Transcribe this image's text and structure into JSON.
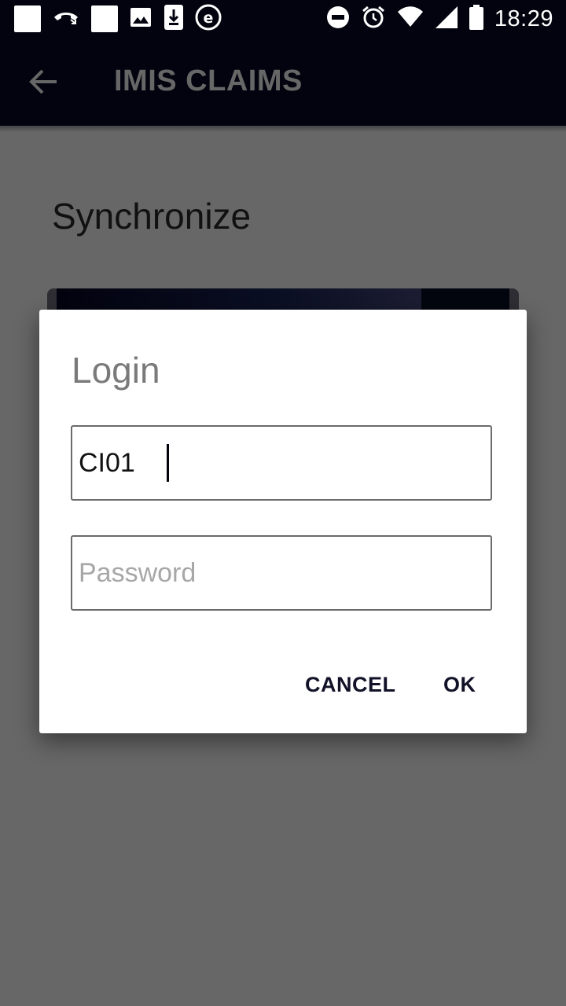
{
  "status_bar": {
    "time": "18:29",
    "left_icons": [
      "blank-notification-icon",
      "missed-call-icon",
      "blank-notification-icon",
      "image-icon",
      "download-icon",
      "e-app-icon"
    ],
    "right_icons": [
      "do-not-disturb-icon",
      "alarm-icon",
      "wifi-icon",
      "signal-icon",
      "battery-icon"
    ]
  },
  "app_bar": {
    "title": "IMIS CLAIMS",
    "back_icon": "arrow-left-icon"
  },
  "page": {
    "heading": "Synchronize"
  },
  "dialog": {
    "title": "Login",
    "username_value": "CI01",
    "password_placeholder": "Password",
    "cancel_label": "CANCEL",
    "ok_label": "OK"
  },
  "colors": {
    "bar_background": "#03030f",
    "scrim": "#676767",
    "dialog_background": "#ffffff"
  }
}
